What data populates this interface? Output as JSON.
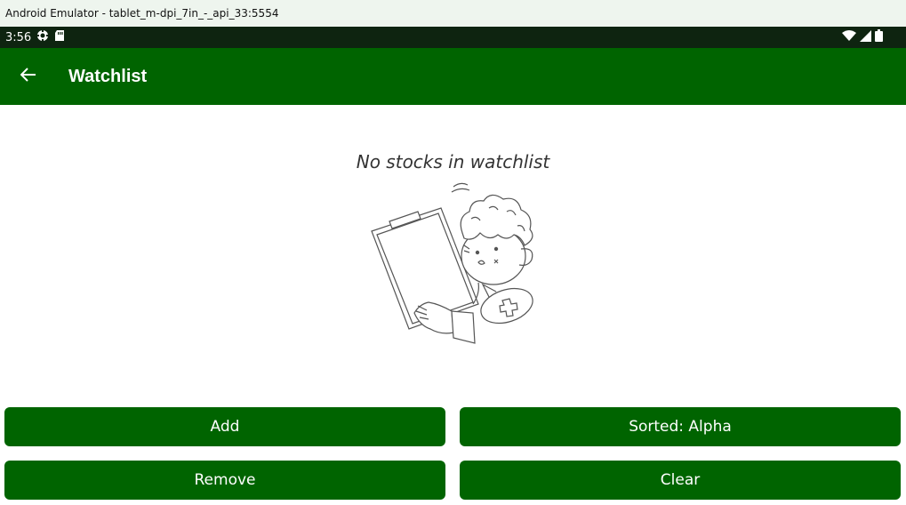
{
  "window": {
    "title": "Android Emulator - tablet_m-dpi_7in_-_api_33:5554"
  },
  "status_bar": {
    "time": "3:56",
    "icons": [
      "settings-notification-icon",
      "sd-card-icon",
      "wifi-icon",
      "signal-icon",
      "battery-icon"
    ]
  },
  "app_bar": {
    "title": "Watchlist",
    "back_icon": "arrow-back-icon",
    "color": "#006400"
  },
  "empty_state": {
    "message": "No stocks in watchlist",
    "illustration": "person-with-clipboard-illustration"
  },
  "buttons": {
    "add": "Add",
    "sort": "Sorted: Alpha",
    "remove": "Remove",
    "clear": "Clear"
  },
  "colors": {
    "primary": "#006400",
    "status_bar": "#0e2410"
  }
}
